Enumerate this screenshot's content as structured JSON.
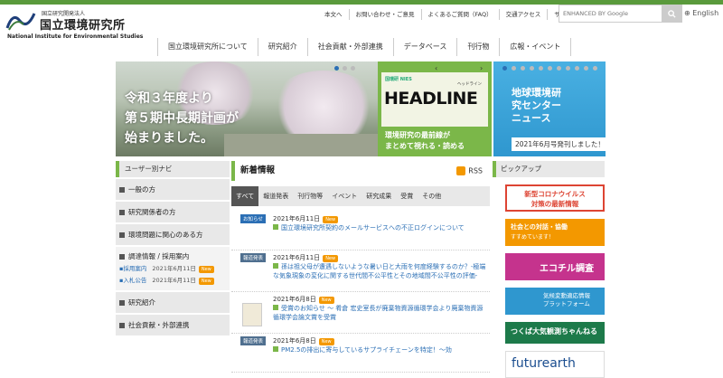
{
  "header": {
    "logo_small": "国立研究開発法人",
    "logo_jp": "国立環境研究所",
    "logo_en": "National Institute for Environmental Studies",
    "util_links": [
      "本文へ",
      "お問い合わせ・ご意見",
      "よくあるご質問（FAQ）",
      "交通アクセス",
      "サイトマップ"
    ],
    "search_placeholder": "ENHANCED BY Google",
    "lang": "English"
  },
  "global_nav": [
    "国立環境研究所について",
    "研究紹介",
    "社会貢献・外部連携",
    "データベース",
    "刊行物",
    "広報・イベント"
  ],
  "hero": {
    "lines": [
      "令和３年度より",
      "第５期中長期計画が",
      "始まりました。"
    ]
  },
  "headline_banner": {
    "logo": "国環研 NIES",
    "kana": "ヘッドライン",
    "title": "HEADLINE",
    "sub1": "環境研究の最前線が",
    "sub2": "まとめて視れる・読める"
  },
  "cger_banner": {
    "title1": "地球環境研",
    "title2": "究センター",
    "title3": "ニュース",
    "badge": "2021年6月号発刊しました！"
  },
  "user_nav": {
    "heading": "ユーザー別ナビ",
    "items": [
      "一般の方",
      "研究関係者の方",
      "環境問題に関心のある方"
    ],
    "procurement": {
      "title": "調達情報 / 採用案内",
      "sub": [
        {
          "label": "採用案内",
          "date": "2021年6月11日",
          "badge": "New"
        },
        {
          "label": "入札公告",
          "date": "2021年6月11日",
          "badge": "New"
        }
      ]
    },
    "more": [
      "研究紹介",
      "社会貢献・外部連携"
    ]
  },
  "news": {
    "heading": "新着情報",
    "rss": "RSS",
    "tabs": [
      "すべて",
      "報道発表",
      "刊行物等",
      "イベント",
      "研究成果",
      "受賞",
      "その他"
    ],
    "active_tab": "すべて",
    "items": [
      {
        "category": "お知らせ",
        "cat_class": "info",
        "date": "2021年6月11日",
        "badge": "New",
        "text": "国立環境研究所契約のメールサービスへの不正ログインについて"
      },
      {
        "category": "報道発表",
        "cat_class": "press",
        "date": "2021年6月11日",
        "badge": "New",
        "text": "孫は祖父母が遭遇しないような暑い日と大雨を何度経験するのか？-極端な気象現象の変化に関する世代間不公平性とその地域間不公平性の評価-"
      },
      {
        "category": "",
        "cat_class": "",
        "date": "2021年6月8日",
        "badge": "New",
        "text": "受賞のお知らせ 〜 肴倉 宏史室長が廃棄物資源循環学会より廃棄物資源循環学会論文賞を受賞"
      },
      {
        "category": "報道発表",
        "cat_class": "press",
        "date": "2021年6月8日",
        "badge": "New",
        "text": "PM2.5の排出に寄与しているサプライチェーンを特定！〜効"
      }
    ]
  },
  "pickup": {
    "heading": "ピックアップ",
    "banners": [
      {
        "line1": "新型コロナウイルス",
        "line2": "対策の最新情報"
      },
      {
        "line1": "社会との対話・協働",
        "line2": "すすめています！"
      },
      {
        "line1": "エコチル調査"
      },
      {
        "line1": "気候変動適応情報",
        "line2": "プラットフォーム"
      },
      {
        "line1": "つくば大気観測ちゃんねる"
      },
      {
        "line1": "futurearth"
      }
    ]
  },
  "colors": {
    "accent_green": "#7bb749",
    "link_blue": "#2b6fb5",
    "new_orange": "#f39800"
  }
}
